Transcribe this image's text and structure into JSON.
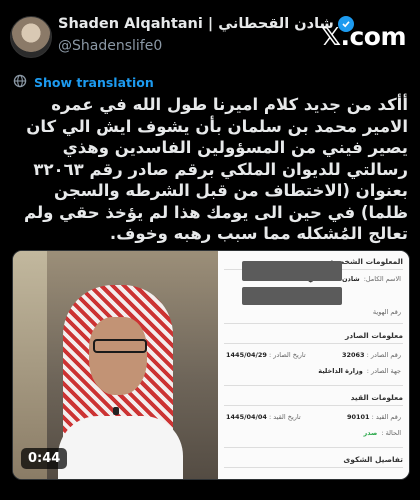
{
  "header": {
    "display_name": "Shaden Alqahtani | شادن القحطاني",
    "handle": "@Shadenslife0",
    "x_logo": "𝕏.com",
    "verified_color": "#1d9bf0"
  },
  "translation": {
    "label": "Show translation",
    "icon": "globe-icon"
  },
  "tweet": {
    "text": "أأكد من جديد كلام اميرنا طول الله في عمره الامير محمد بن سلمان بأن يشوف ايش الي كان يصير فيني من المسؤولين الفاسدين وهذي رسالتي للديوان الملكي برقم صادر رقم ٣٢٠٦٣ بعنوان (الاختطاف من قبل الشرطه والسجن ظلما) في حين الى يومك هذا لم يؤخذ حقي ولم تعالج المُشكله مما سبب رهبه وخوف."
  },
  "video": {
    "duration": "0:44"
  },
  "document": {
    "sec_personal": "المعلومات الشخصية",
    "full_name_label": "الاسم الكامل:",
    "full_name_value": "شادن القحطاني",
    "id_label": "رقم الهوية",
    "sec_outgoing": "معلومات الصادر",
    "out_number_label": "رقم الصادر :",
    "out_number_value": "32063",
    "out_date_label": "تاريخ الصادر :",
    "out_date_value": "1445/04/29",
    "out_entity_label": "جهة الصادر :",
    "out_entity_value": "وزارة الداخلية",
    "sec_record": "معلومات القيد",
    "rec_number_label": "رقم القيد :",
    "rec_number_value": "90101",
    "rec_date_label": "تاريخ القيد :",
    "rec_date_value": "1445/04/04",
    "status_label": "الحالة :",
    "status_value": "صدر",
    "sec_complaint": "تفاصيل الشكوى"
  }
}
